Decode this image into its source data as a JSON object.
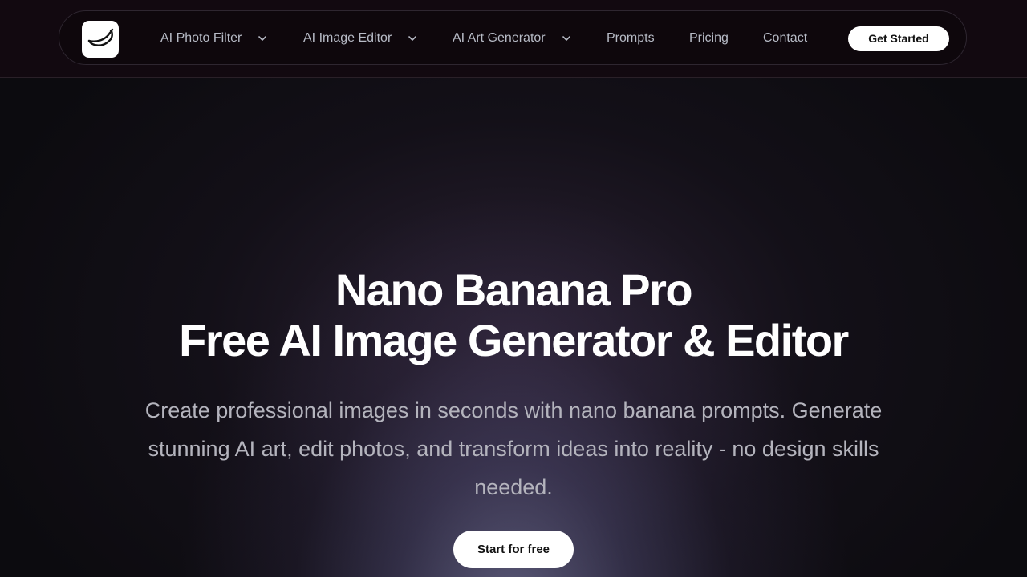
{
  "header": {
    "logo_icon": "banana-icon",
    "nav": [
      {
        "label": "AI Photo Filter",
        "has_dropdown": true
      },
      {
        "label": "AI Image Editor",
        "has_dropdown": true
      },
      {
        "label": "AI Art Generator",
        "has_dropdown": true
      },
      {
        "label": "Prompts",
        "has_dropdown": false
      },
      {
        "label": "Pricing",
        "has_dropdown": false
      },
      {
        "label": "Contact",
        "has_dropdown": false
      }
    ],
    "cta_label": "Get Started"
  },
  "hero": {
    "title_line1": "Nano Banana Pro",
    "title_line2": "Free AI Image Generator & Editor",
    "subtitle": "Create professional images in seconds with nano banana prompts. Generate stunning AI art, edit photos, and transform ideas into reality - no design skills needed.",
    "cta_label": "Start for free"
  },
  "colors": {
    "background": "#0c0b0f",
    "header_bg": "#120910",
    "nav_text": "#b7bbc6",
    "button_bg": "#ffffff"
  }
}
